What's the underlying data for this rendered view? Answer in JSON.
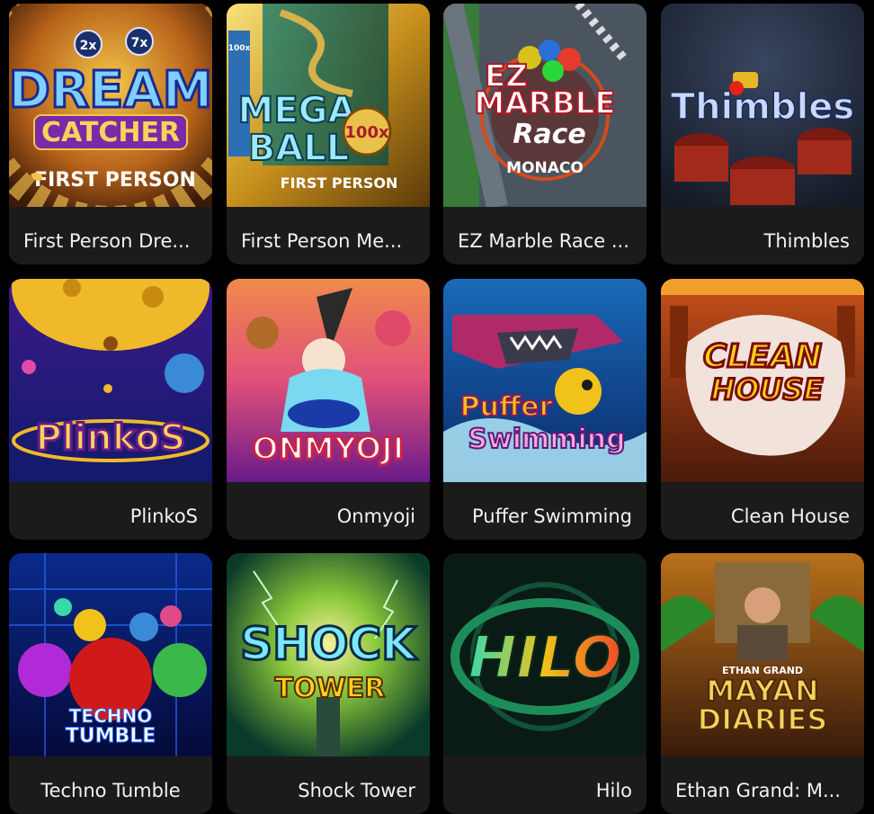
{
  "games": [
    {
      "title": "First Person Dre...",
      "logo": [
        "DREAM",
        "CATCHER",
        "FIRST PERSON"
      ],
      "badges": [
        "2x",
        "7x"
      ]
    },
    {
      "title": "First Person Me...",
      "logo": [
        "MEGA",
        "BALL",
        "FIRST PERSON"
      ],
      "badges": [
        "100x",
        "100x"
      ]
    },
    {
      "title": "EZ Marble Race ...",
      "logo": [
        "EZ",
        "MARBLE",
        "Race",
        "MONACO"
      ]
    },
    {
      "title": "Thimbles",
      "logo": [
        "Thimbles"
      ]
    },
    {
      "title": "PlinkoS",
      "logo": [
        "PlinkoS"
      ]
    },
    {
      "title": "Onmyoji",
      "logo": [
        "ONMYOJI"
      ]
    },
    {
      "title": "Puffer Swimming",
      "logo": [
        "Puffer",
        "Swimming"
      ]
    },
    {
      "title": "Clean House",
      "logo": [
        "CLEAN",
        "HOUSE"
      ]
    },
    {
      "title": "Techno Tumble",
      "logo": [
        "TECHNO",
        "TUMBLE"
      ]
    },
    {
      "title": "Shock Tower",
      "logo": [
        "SHOCK",
        "TOWER"
      ]
    },
    {
      "title": "Hilo",
      "logo": [
        "HILO"
      ]
    },
    {
      "title": "Ethan Grand: M...",
      "logo": [
        "ETHAN GRAND",
        "MAYAN",
        "DIARIES"
      ]
    }
  ]
}
